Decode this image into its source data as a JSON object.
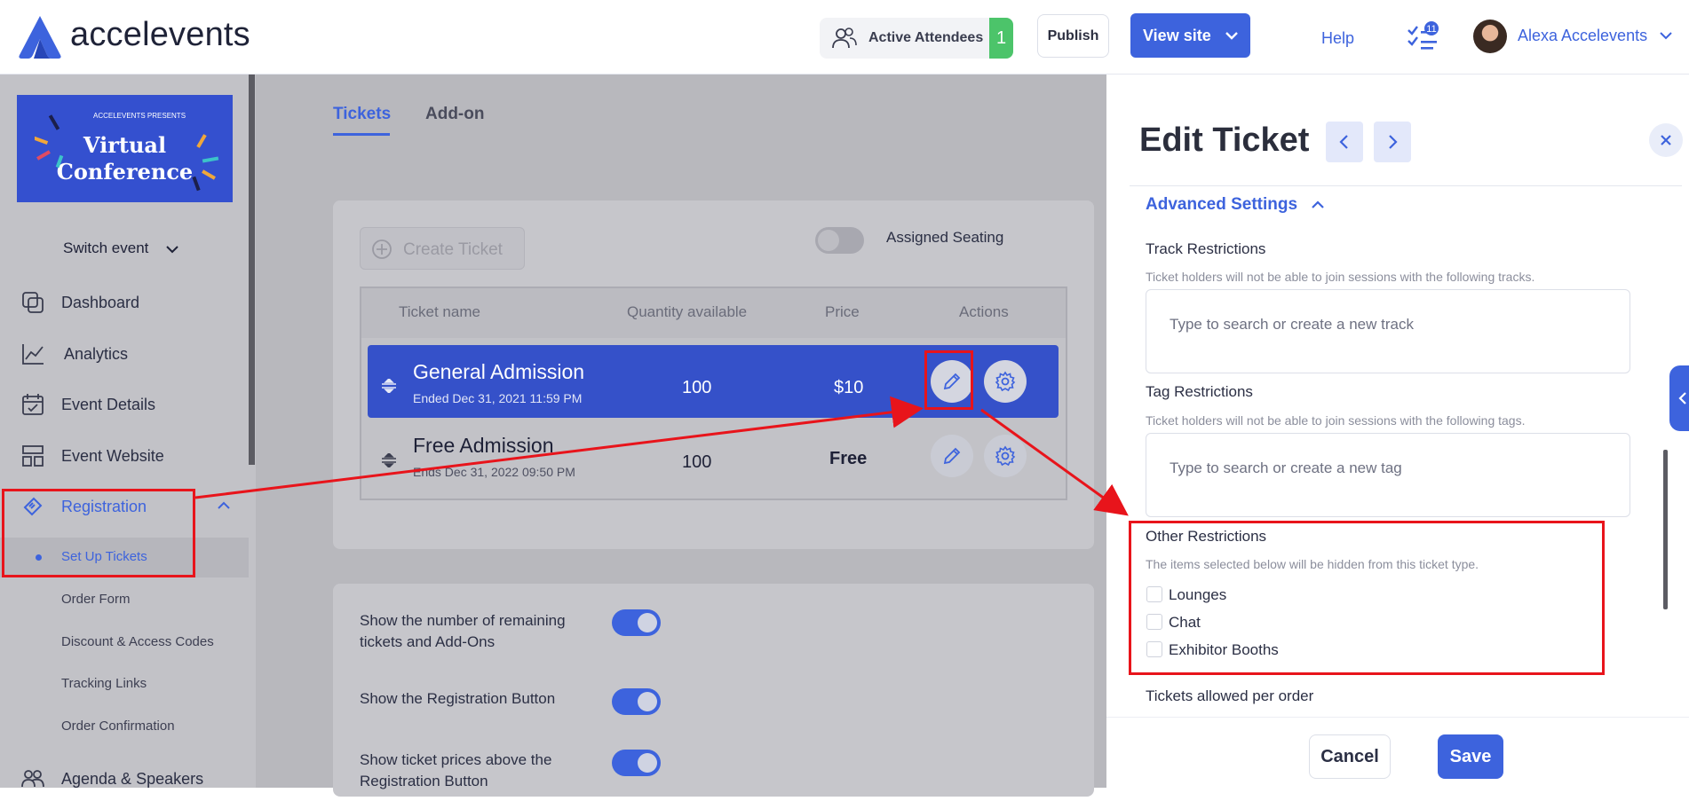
{
  "header": {
    "brand": "accelevents",
    "active_attendees_label": "Active Attendees",
    "active_attendees_count": "1",
    "publish_label": "Publish",
    "view_site_label": "View site",
    "help_label": "Help",
    "tasks_badge": "11",
    "user_name": "Alexa Accelevents",
    "brand_color": "#3d63dd"
  },
  "sidebar": {
    "banner_small": "ACCELEVENTS PRESENTS",
    "banner_title_line1": "Virtual",
    "banner_title_line2": "Conference",
    "switch_event": "Switch event",
    "items": [
      {
        "label": "Dashboard",
        "icon": "dashboard-icon"
      },
      {
        "label": "Analytics",
        "icon": "analytics-icon"
      },
      {
        "label": "Event Details",
        "icon": "calendar-check-icon"
      },
      {
        "label": "Event Website",
        "icon": "layout-icon"
      },
      {
        "label": "Registration",
        "icon": "ticket-icon"
      },
      {
        "label": "Agenda & Speakers",
        "icon": "people-icon"
      }
    ],
    "registration_sub": [
      "Set Up Tickets",
      "Order Form",
      "Discount & Access Codes",
      "Tracking Links",
      "Order Confirmation"
    ]
  },
  "main": {
    "tabs": [
      "Tickets",
      "Add-on"
    ],
    "create_ticket": "Create Ticket",
    "assigned_seating": "Assigned Seating",
    "columns": [
      "Ticket name",
      "Quantity available",
      "Price",
      "Actions"
    ],
    "tickets": [
      {
        "name": "General Admission",
        "sub": "Ended Dec 31, 2021 11:59 PM",
        "qty": "100",
        "price": "$10"
      },
      {
        "name": "Free Admission",
        "sub": "Ends Dec 31, 2022 09:50 PM",
        "qty": "100",
        "price": "Free"
      }
    ],
    "options": [
      "Show the number of remaining tickets and Add-Ons",
      "Show the Registration Button",
      "Show ticket prices above the Registration Button"
    ]
  },
  "drawer": {
    "title": "Edit Ticket",
    "advanced": "Advanced Settings",
    "track_title": "Track Restrictions",
    "track_desc": "Ticket holders will not be able to join sessions with the following tracks.",
    "track_placeholder": "Type to search  or create a new track",
    "tag_title": "Tag Restrictions",
    "tag_desc": "Ticket holders will not be able to join sessions with the following tags.",
    "tag_placeholder": "Type to search  or create a new tag",
    "other_title": "Other Restrictions",
    "other_desc": "The items selected below will be hidden from this ticket type.",
    "other_items": [
      "Lounges",
      "Chat",
      "Exhibitor Booths"
    ],
    "tickets_allowed": "Tickets allowed per order",
    "cancel": "Cancel",
    "save": "Save"
  },
  "annotation_color": "#e8141b"
}
